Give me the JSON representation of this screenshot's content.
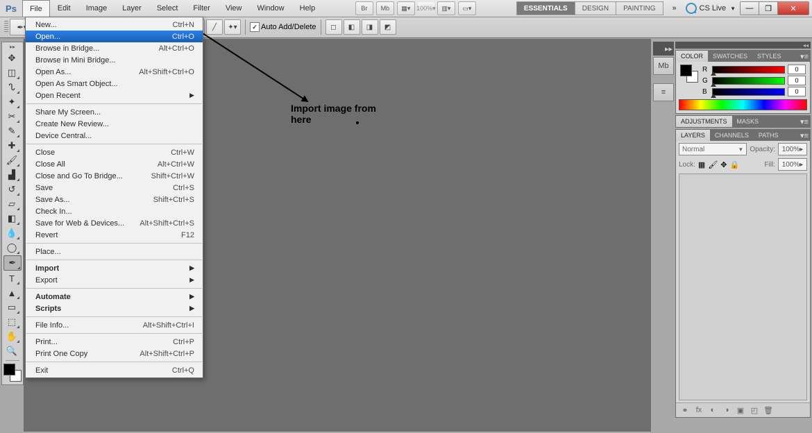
{
  "app": {
    "name": "Ps"
  },
  "menubar": [
    "File",
    "Edit",
    "Image",
    "Layer",
    "Select",
    "Filter",
    "View",
    "Window",
    "Help"
  ],
  "menubar_open_index": 0,
  "topbar": {
    "zoom": "100%",
    "workspaces": [
      "ESSENTIALS",
      "DESIGN",
      "PAINTING"
    ],
    "workspace_active": 0,
    "cs_live": "CS Live"
  },
  "optionsbar": {
    "mode": "Paths",
    "auto_add_delete_label": "Auto Add/Delete",
    "auto_add_delete_checked": true
  },
  "file_menu": [
    {
      "label": "New...",
      "sc": "Ctrl+N"
    },
    {
      "label": "Open...",
      "sc": "Ctrl+O",
      "hi": true
    },
    {
      "label": "Browse in Bridge...",
      "sc": "Alt+Ctrl+O"
    },
    {
      "label": "Browse in Mini Bridge..."
    },
    {
      "label": "Open As...",
      "sc": "Alt+Shift+Ctrl+O"
    },
    {
      "label": "Open As Smart Object..."
    },
    {
      "label": "Open Recent",
      "sub": true
    },
    {
      "divider": true
    },
    {
      "label": "Share My Screen..."
    },
    {
      "label": "Create New Review..."
    },
    {
      "label": "Device Central..."
    },
    {
      "divider": true
    },
    {
      "label": "Close",
      "sc": "Ctrl+W"
    },
    {
      "label": "Close All",
      "sc": "Alt+Ctrl+W"
    },
    {
      "label": "Close and Go To Bridge...",
      "sc": "Shift+Ctrl+W"
    },
    {
      "label": "Save",
      "sc": "Ctrl+S"
    },
    {
      "label": "Save As...",
      "sc": "Shift+Ctrl+S"
    },
    {
      "label": "Check In..."
    },
    {
      "label": "Save for Web & Devices...",
      "sc": "Alt+Shift+Ctrl+S"
    },
    {
      "label": "Revert",
      "sc": "F12"
    },
    {
      "divider": true
    },
    {
      "label": "Place..."
    },
    {
      "divider": true
    },
    {
      "label": "Import",
      "sub": true,
      "bold": true
    },
    {
      "label": "Export",
      "sub": true
    },
    {
      "divider": true
    },
    {
      "label": "Automate",
      "sub": true,
      "bold": true
    },
    {
      "label": "Scripts",
      "sub": true,
      "bold": true
    },
    {
      "divider": true
    },
    {
      "label": "File Info...",
      "sc": "Alt+Shift+Ctrl+I"
    },
    {
      "divider": true
    },
    {
      "label": "Print...",
      "sc": "Ctrl+P"
    },
    {
      "label": "Print One Copy",
      "sc": "Alt+Shift+Ctrl+P"
    },
    {
      "divider": true
    },
    {
      "label": "Exit",
      "sc": "Ctrl+Q"
    }
  ],
  "annotation": {
    "text": "Import image from here"
  },
  "tools": [
    {
      "n": "move-tool",
      "g": "✥"
    },
    {
      "n": "marquee-tool",
      "g": "◫",
      "c": true
    },
    {
      "n": "lasso-tool",
      "g": "ᔐ",
      "c": true
    },
    {
      "n": "magic-wand-tool",
      "g": "✦",
      "c": true
    },
    {
      "n": "crop-tool",
      "g": "✂",
      "c": true
    },
    {
      "n": "eyedropper-tool",
      "g": "✎",
      "c": true
    },
    {
      "n": "healing-brush-tool",
      "g": "✚",
      "c": true
    },
    {
      "n": "brush-tool",
      "g": "🖌",
      "c": true
    },
    {
      "n": "clone-stamp-tool",
      "g": "▟",
      "c": true
    },
    {
      "n": "history-brush-tool",
      "g": "↺",
      "c": true
    },
    {
      "n": "eraser-tool",
      "g": "▱",
      "c": true
    },
    {
      "n": "gradient-tool",
      "g": "◧",
      "c": true
    },
    {
      "n": "blur-tool",
      "g": "💧",
      "c": true
    },
    {
      "n": "dodge-tool",
      "g": "◯",
      "c": true
    },
    {
      "n": "pen-tool",
      "g": "✒",
      "c": true,
      "active": true
    },
    {
      "n": "type-tool",
      "g": "T",
      "c": true
    },
    {
      "n": "path-selection-tool",
      "g": "▲",
      "c": true
    },
    {
      "n": "shape-tool",
      "g": "▭",
      "c": true
    },
    {
      "n": "3d-tool",
      "g": "⬚",
      "c": true
    },
    {
      "n": "hand-tool",
      "g": "✋",
      "c": true
    },
    {
      "n": "zoom-tool",
      "g": "🔍"
    }
  ],
  "panels": {
    "color": {
      "tabs": [
        "COLOR",
        "SWATCHES",
        "STYLES"
      ],
      "r": "0",
      "g": "0",
      "b": "0"
    },
    "adjustments": {
      "tabs": [
        "ADJUSTMENTS",
        "MASKS"
      ]
    },
    "layers": {
      "tabs": [
        "LAYERS",
        "CHANNELS",
        "PATHS"
      ],
      "blend": "Normal",
      "opacity_label": "Opacity:",
      "opacity": "100%",
      "lock_label": "Lock:",
      "fill_label": "Fill:",
      "fill": "100%"
    }
  }
}
